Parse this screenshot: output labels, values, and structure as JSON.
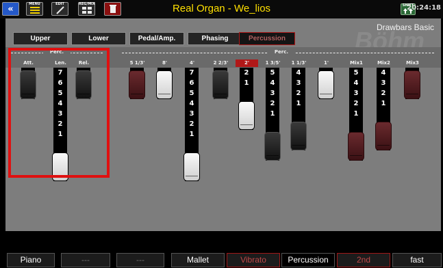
{
  "header": {
    "title": "Real Organ - We_lios",
    "time": "20:24:18",
    "buttons": {
      "back_icon": "«",
      "menu": "MENU",
      "edit": "EDIT",
      "reg": "REG/MIX",
      "shift": "SHIFT"
    }
  },
  "panel": {
    "subtitle": "Drawbars Basic",
    "watermark": "Böhm",
    "tabs": [
      {
        "label": "Upper",
        "active": false
      },
      {
        "label": "Lower",
        "active": false
      },
      {
        "label": "Pedal/Amp.",
        "active": false
      },
      {
        "label": "Phasing",
        "active": false
      },
      {
        "label": "Percussion",
        "active": true
      }
    ],
    "groups": {
      "perc_left": "Perc.",
      "perc_right": "Perc."
    },
    "labels": [
      "Att.",
      "Len.",
      "Rel.",
      "5 1/3'",
      "8'",
      "4'",
      "2 2/3'",
      "2'",
      "1 3/5'",
      "1 1/3'",
      "1'",
      "Mix1",
      "Mix2",
      "Mix3"
    ],
    "selected_label": "2'"
  },
  "drawbars": [
    {
      "label": "Att.",
      "value": 0,
      "color": "#1a1a1a"
    },
    {
      "label": "Len.",
      "value": 8,
      "color": "#f0f0f0"
    },
    {
      "label": "Rel.",
      "value": 0,
      "color": "#1a1a1a"
    },
    {
      "label": "5 1/3'",
      "value": 0,
      "color": "#5a1f23"
    },
    {
      "label": "8'",
      "value": 0,
      "color": "#f0f0f0"
    },
    {
      "label": "4'",
      "value": 8,
      "color": "#f0f0f0"
    },
    {
      "label": "2 2/3'",
      "value": 0,
      "color": "#1a1a1a"
    },
    {
      "label": "2'",
      "value": 3,
      "color": "#f0f0f0"
    },
    {
      "label": "1 3/5'",
      "value": 6,
      "color": "#1a1a1a"
    },
    {
      "label": "1 1/3'",
      "value": 5,
      "color": "#1a1a1a"
    },
    {
      "label": "1'",
      "value": 0,
      "color": "#f0f0f0"
    },
    {
      "label": "Mix1",
      "value": 6,
      "color": "#5a1f23"
    },
    {
      "label": "Mix2",
      "value": 5,
      "color": "#5a1f23"
    },
    {
      "label": "Mix3",
      "value": 0,
      "color": "#5a1f23"
    }
  ],
  "function_bar": [
    {
      "label": "Piano",
      "state": "normal"
    },
    {
      "label": "---",
      "state": "dim"
    },
    {
      "label": "---",
      "state": "dim"
    },
    {
      "label": "Mallet",
      "state": "normal"
    },
    {
      "label": "Vibrato",
      "state": "red"
    },
    {
      "label": "Percussion",
      "state": "active"
    },
    {
      "label": "2nd",
      "state": "red"
    },
    {
      "label": "fast",
      "state": "normal"
    }
  ]
}
